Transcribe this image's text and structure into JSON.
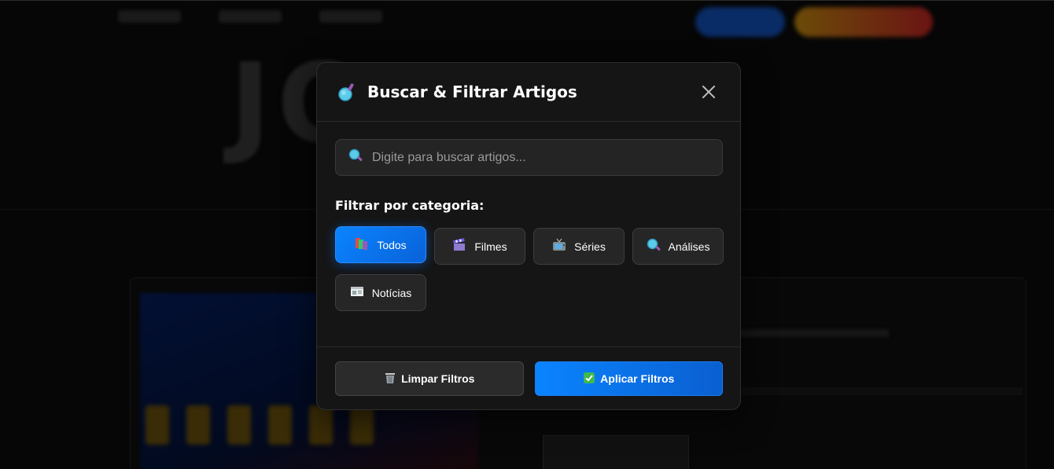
{
  "modal": {
    "title": "Buscar & Filtrar Artigos",
    "title_icon": "magnifier-icon",
    "close_icon": "close-icon"
  },
  "search": {
    "placeholder": "Digite para buscar artigos...",
    "value": "",
    "icon": "search-icon"
  },
  "filter": {
    "label": "Filtrar por categoria:",
    "categories": [
      {
        "label": "Todos",
        "icon": "books-icon",
        "active": true
      },
      {
        "label": "Filmes",
        "icon": "clapperboard-icon",
        "active": false
      },
      {
        "label": "Séries",
        "icon": "tv-icon",
        "active": false
      },
      {
        "label": "Análises",
        "icon": "magnifier-icon",
        "active": false
      },
      {
        "label": "Notícias",
        "icon": "newspaper-icon",
        "active": false
      }
    ]
  },
  "footer": {
    "clear_label": "Limpar Filtros",
    "clear_icon": "wastebasket-icon",
    "apply_label": "Aplicar Filtros",
    "apply_icon": "check-mark-icon"
  },
  "colors": {
    "accent": "#0a84ff",
    "modal_bg": "#151515",
    "button_bg": "#262626"
  }
}
